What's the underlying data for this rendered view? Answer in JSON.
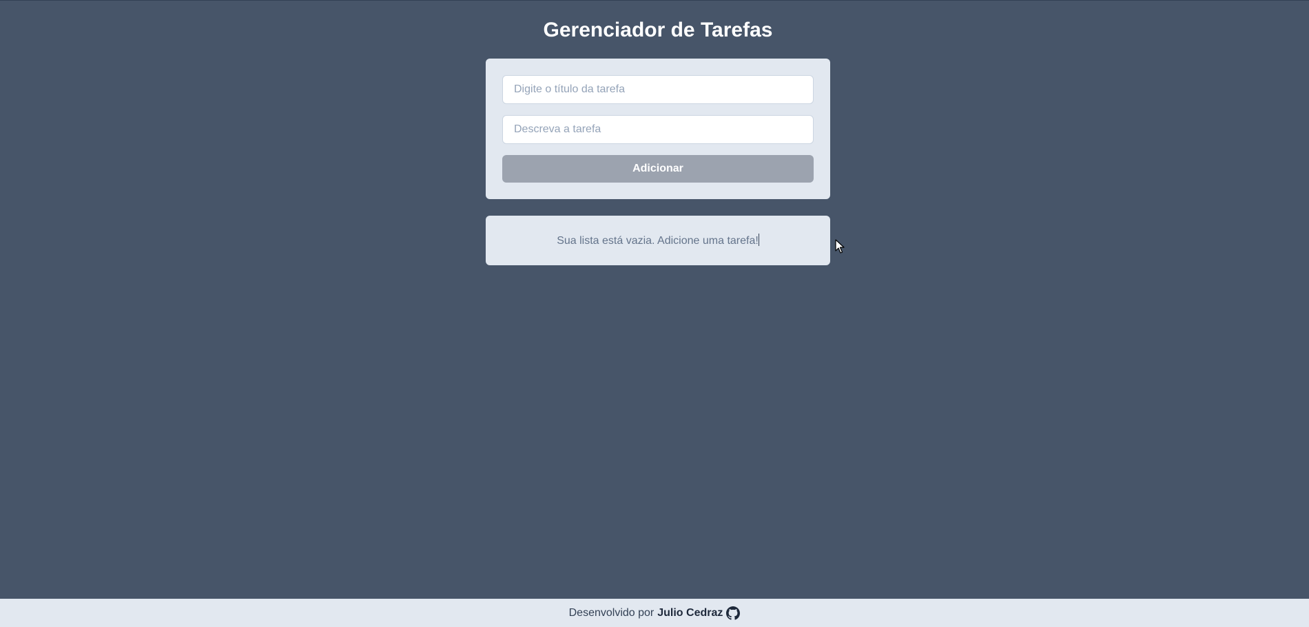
{
  "app": {
    "title": "Gerenciador de Tarefas"
  },
  "form": {
    "title_placeholder": "Digite o título da tarefa",
    "title_value": "",
    "description_placeholder": "Descreva a tarefa",
    "description_value": "",
    "add_button_label": "Adicionar"
  },
  "task_list": {
    "empty_message": "Sua lista está vazia. Adicione uma tarefa!"
  },
  "footer": {
    "prefix": "Desenvolvido por",
    "author": "Julio Cedraz",
    "icon": "github-icon"
  },
  "colors": {
    "background": "#475569",
    "card": "#e2e8f0",
    "button": "#9ca3af",
    "footer": "#e2e8f0"
  }
}
